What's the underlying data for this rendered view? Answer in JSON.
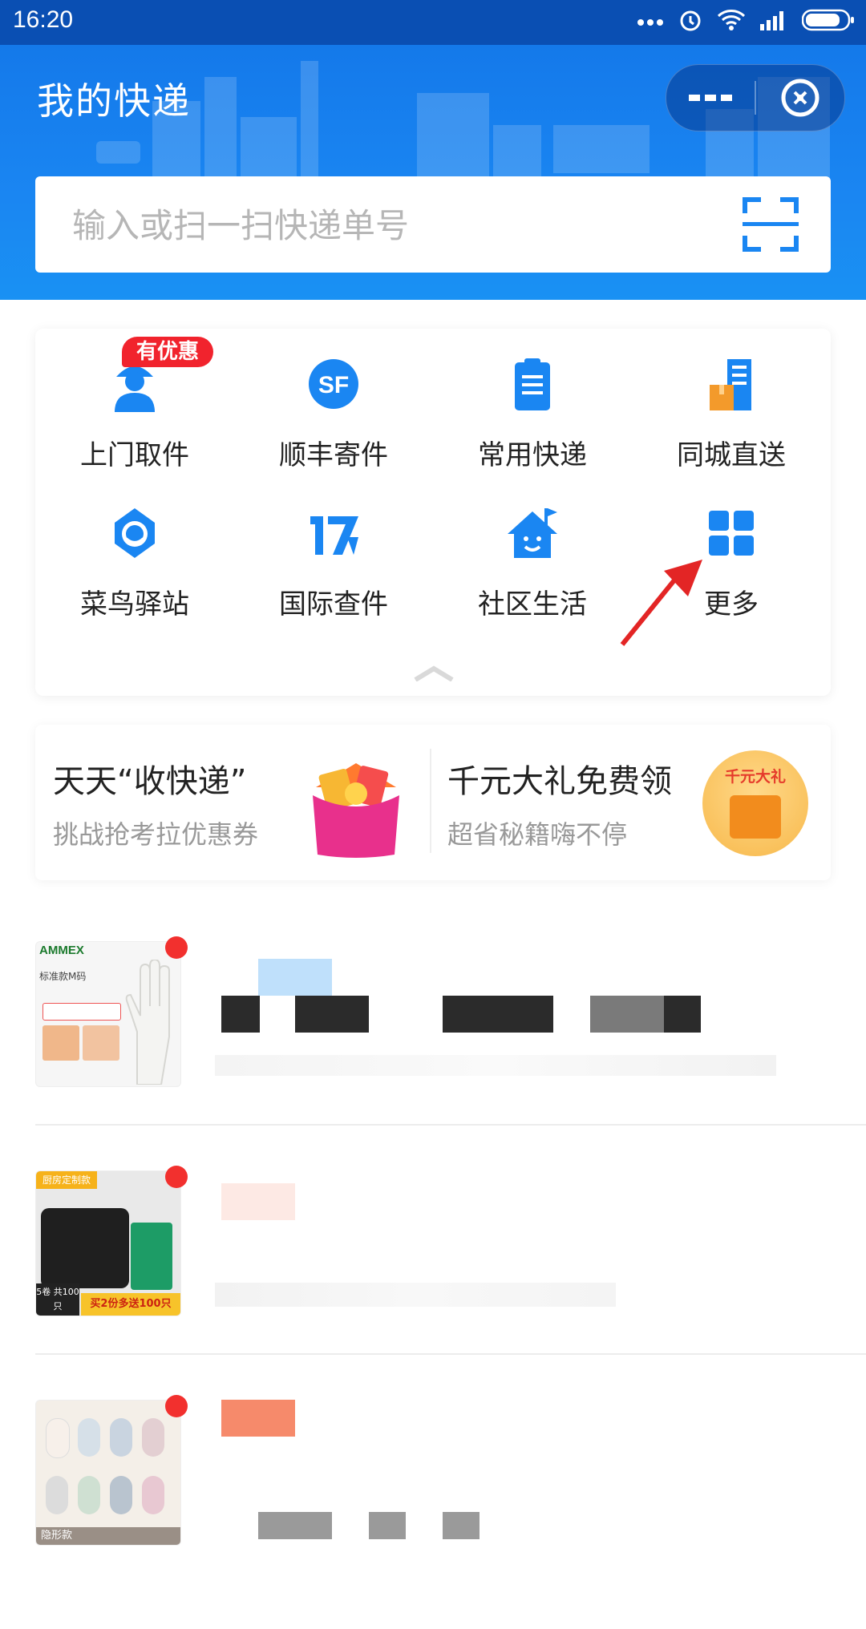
{
  "status_bar": {
    "time": "16:20"
  },
  "header": {
    "title": "我的快递",
    "search_placeholder": "输入或扫一扫快递单号"
  },
  "services": {
    "badge": "有优惠",
    "items": [
      {
        "label": "上门取件",
        "icon": "courier-pickup-icon"
      },
      {
        "label": "顺丰寄件",
        "icon": "sf-express-icon"
      },
      {
        "label": "常用快递",
        "icon": "clipboard-icon"
      },
      {
        "label": "同城直送",
        "icon": "city-delivery-icon"
      },
      {
        "label": "菜鸟驿站",
        "icon": "cainiao-bird-icon"
      },
      {
        "label": "国际查件",
        "icon": "international-17-icon"
      },
      {
        "label": "社区生活",
        "icon": "community-house-icon"
      },
      {
        "label": "更多",
        "icon": "grid-more-icon"
      }
    ]
  },
  "promos": [
    {
      "title": "天天“收快递”",
      "subtitle": "挑战抢考拉优惠券"
    },
    {
      "title": "千元大礼免费领",
      "subtitle": "超省秘籍嗨不停",
      "image_text": "千元大礼"
    }
  ],
  "parcels": [
    {
      "thumb_brand": "AMMEX",
      "thumb_text": "标准款M码"
    },
    {
      "thumb_text": "厨房定制款",
      "thumb_text2": "买2份多送100只",
      "thumb_text3": "5卷 共100只"
    },
    {
      "thumb_text": "隐形款"
    }
  ],
  "colors": {
    "brand_blue": "#1a86f2",
    "red": "#f1232d"
  }
}
